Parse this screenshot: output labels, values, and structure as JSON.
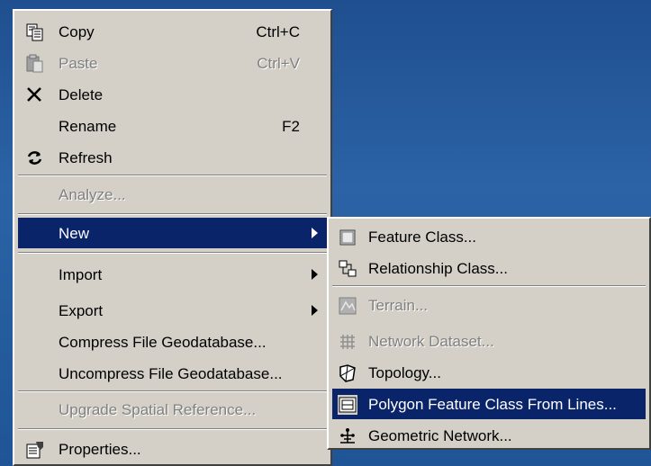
{
  "context_menu": {
    "items": [
      {
        "label": "Copy",
        "shortcut": "Ctrl+C",
        "icon": "copy-icon"
      },
      {
        "label": "Paste",
        "shortcut": "Ctrl+V",
        "icon": "paste-icon",
        "disabled": true
      },
      {
        "label": "Delete",
        "icon": "delete-icon"
      },
      {
        "label": "Rename",
        "shortcut": "F2"
      },
      {
        "label": "Refresh",
        "icon": "refresh-icon"
      },
      {
        "label": "Analyze...",
        "disabled": true
      },
      {
        "label": "New",
        "submenu": true,
        "selected": true
      },
      {
        "label": "Import",
        "submenu": true
      },
      {
        "label": "Export",
        "submenu": true
      },
      {
        "label": "Compress File Geodatabase..."
      },
      {
        "label": "Uncompress File Geodatabase..."
      },
      {
        "label": "Upgrade Spatial Reference...",
        "disabled": true
      },
      {
        "label": "Properties...",
        "icon": "properties-icon"
      }
    ]
  },
  "new_submenu": {
    "items": [
      {
        "label": "Feature Class...",
        "icon": "feature-class-icon"
      },
      {
        "label": "Relationship Class...",
        "icon": "relationship-class-icon"
      },
      {
        "label": "Terrain...",
        "icon": "terrain-icon",
        "disabled": true
      },
      {
        "label": "Network Dataset...",
        "icon": "network-dataset-icon",
        "disabled": true
      },
      {
        "label": "Topology...",
        "icon": "topology-icon"
      },
      {
        "label": "Polygon Feature Class From Lines...",
        "icon": "polygon-feature-class-icon",
        "selected": true
      },
      {
        "label": "Geometric Network...",
        "icon": "geometric-network-icon"
      }
    ]
  },
  "colors": {
    "menu_background": "#d4d0c8",
    "selection": "#0a246a",
    "desktop": "#1f4f8f",
    "disabled_text": "#808080"
  }
}
